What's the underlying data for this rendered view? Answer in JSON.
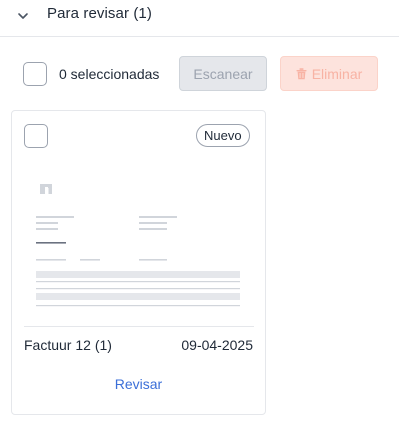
{
  "section": {
    "title": "Para revisar (1)",
    "expanded": true,
    "chevron_icon": "chevron-down-icon"
  },
  "toolbar": {
    "selected_count_label": "0 seleccionadas",
    "scan_label": "Escanear",
    "delete_label": "Eliminar",
    "delete_icon": "trash-icon",
    "scan_disabled": true,
    "delete_disabled": true
  },
  "cards": [
    {
      "badge": "Nuevo",
      "name": "Factuur 12 (1)",
      "date": "09-04-2025",
      "action_label": "Revisar",
      "thumbnail_icon": "document-thumbnail-icon"
    }
  ],
  "colors": {
    "link": "#3b6fd8",
    "delete_bg": "#fde3dd",
    "delete_text": "#f8b3a4",
    "scan_bg": "#e5e7eb",
    "scan_text": "#9ca3af",
    "border": "#e5e7eb"
  }
}
